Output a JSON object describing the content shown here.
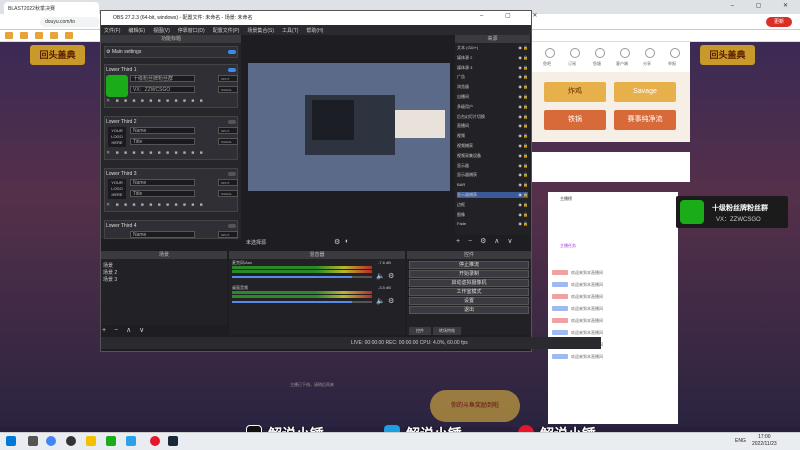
{
  "browser": {
    "tab_title": "BLAST2022秋季决赛",
    "address": "douyu.com/to",
    "update_label": "更新",
    "window_controls": "– ▢ ✕"
  },
  "douyu": {
    "banner_left": "回头盖典",
    "banner_right": "回头盖典",
    "top_icons": [
      "鱼吧",
      "订阅",
      "鱼塘",
      "客户端",
      "分享",
      "举报"
    ],
    "vote_buttons": [
      "炸鸡",
      "Savage",
      "铁锅",
      "赛事纯净流"
    ],
    "chat": {
      "tabs": [
        "主播榜",
        "主播任务"
      ],
      "lines": [
        "欢迎来到本直播间",
        "欢迎来到本直播间",
        "欢迎来到本直播间",
        "欢迎来到本直播间",
        "欢迎来到本直播间",
        "欢迎来到本直播间",
        "欢迎来到本直播间",
        "欢迎来到本直播间"
      ]
    },
    "hint": "主播已下线，请稍后再来",
    "gift_banner": "你的斗鱼奖励到啦"
  },
  "obs": {
    "title": "OBS 27.2.3 (64-bit, windows) - 配置文件: 未命名 - 场景: 未命名",
    "window_controls": "– ▢ ✕",
    "menu": [
      "文件(F)",
      "编辑(E)",
      "视图(V)",
      "停靠窗口(D)",
      "配置文件(P)",
      "场景集合(S)",
      "工具(T)",
      "帮助(H)"
    ],
    "dock_title": "功能标题",
    "main_settings": "Main settings",
    "lower_thirds": [
      {
        "title": "Lower Third 1",
        "line1": "十级粉丝牌粉丝群",
        "line2": "VX：ZZWCSGO",
        "line1_tag": "SPLIT",
        "line2_tag": "SIGNAL"
      },
      {
        "title": "Lower Third 2",
        "logo": "YOUR LOGO HERE",
        "line1": "Name",
        "line2": "Title",
        "line1_tag": "SPLIT",
        "line2_tag": "SIGNAL"
      },
      {
        "title": "Lower Third 3",
        "logo": "YOUR LOGO HERE",
        "line1": "Name",
        "line2": "Title",
        "line1_tag": "SPLIT",
        "line2_tag": "SIGNAL"
      },
      {
        "title": "Lower Third 4",
        "logo": "YOUR LOGO HERE",
        "line1": "Name",
        "line2": "Title",
        "line1_tag": "SPLIT",
        "line2_tag": "SIGNAL"
      }
    ],
    "sources_title": "来源",
    "sources": [
      {
        "name": "文本 (GDI+)",
        "selected": false
      },
      {
        "name": "媒体源 2",
        "selected": false
      },
      {
        "name": "媒体源 3",
        "selected": false
      },
      {
        "name": "广告",
        "selected": false
      },
      {
        "name": "浏览器",
        "selected": false
      },
      {
        "name": "自播间",
        "selected": false
      },
      {
        "name": "多级用户",
        "selected": false
      },
      {
        "name": "后台幻灯片切换",
        "selected": false
      },
      {
        "name": "直播间",
        "selected": false
      },
      {
        "name": "视频",
        "selected": false
      },
      {
        "name": "视频捕获",
        "selected": false
      },
      {
        "name": "视频采集设备",
        "selected": false
      },
      {
        "name": "显示器",
        "selected": false
      },
      {
        "name": "显示器捕获",
        "selected": false
      },
      {
        "name": "BAR",
        "selected": false
      },
      {
        "name": "显示器捕获",
        "selected": true
      },
      {
        "name": "边框",
        "selected": false
      },
      {
        "name": "图像",
        "selected": false
      },
      {
        "name": "Fade",
        "selected": false
      }
    ],
    "scene_label": "未选择源",
    "scenes_title": "场景",
    "scenes": [
      "场景",
      "场景 2",
      "场景 3"
    ],
    "mixer_title": "混音器",
    "mixer": [
      {
        "name": "麦克风/Aux",
        "db": "-7.6 dB"
      },
      {
        "name": "桌面音频",
        "db": "-3.5 dB"
      }
    ],
    "controls_title": "控件",
    "controls": [
      "停止推流",
      "开始录制",
      "启动虚拟摄像机",
      "工作室模式",
      "设置",
      "退出"
    ],
    "dock_tabs": [
      "控件",
      "转场特效"
    ],
    "status": "LIVE: 00:00:00   REC: 00:00:00   CPU: 4.0%, 60.00 fps"
  },
  "overlay": {
    "title": "十级粉丝牌粉丝群",
    "subtitle": "VX：ZZWCSGO"
  },
  "watermark": [
    "解说小锤",
    "解说小锤",
    "解说小锤"
  ],
  "taskbar": {
    "lang": "ENG",
    "time": "17:00",
    "date": "2022/11/23"
  }
}
